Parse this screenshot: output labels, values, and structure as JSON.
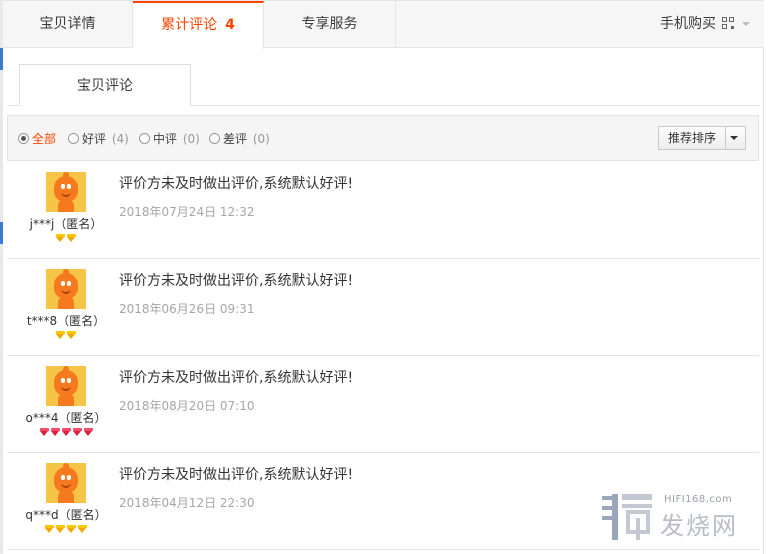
{
  "tabs": {
    "items": [
      "宝贝详情",
      "累计评论",
      "专享服务"
    ],
    "review_count": "4",
    "mobile_label": "手机购买"
  },
  "subtab": {
    "label": "宝贝评论"
  },
  "filter": {
    "options": [
      {
        "label": "全部",
        "count": ""
      },
      {
        "label": "好评",
        "count": "(4)"
      },
      {
        "label": "中评",
        "count": "(0)"
      },
      {
        "label": "差评",
        "count": "(0)"
      }
    ],
    "selected": "全部",
    "sort_label": "推荐排序"
  },
  "reviews": [
    {
      "user": "j***j（匿名）",
      "text": "评价方未及时做出评价,系统默认好评!",
      "date": "2018年07月24日 12:32",
      "rank": {
        "color": "yellow",
        "count": 2
      }
    },
    {
      "user": "t***8（匿名）",
      "text": "评价方未及时做出评价,系统默认好评!",
      "date": "2018年06月26日 09:31",
      "rank": {
        "color": "yellow",
        "count": 2
      }
    },
    {
      "user": "o***4（匿名）",
      "text": "评价方未及时做出评价,系统默认好评!",
      "date": "2018年08月20日 07:10",
      "rank": {
        "color": "red",
        "count": 5
      }
    },
    {
      "user": "q***d（匿名）",
      "text": "评价方未及时做出评价,系统默认好评!",
      "date": "2018年04月12日 22:30",
      "rank": {
        "color": "yellow",
        "count": 4
      }
    }
  ],
  "watermark": {
    "site": "HIFI168.com",
    "name": "发烧网"
  },
  "colors": {
    "accent": "#ff4400",
    "avatar_bg": "#f6c547",
    "mascot": "#f57a1f"
  }
}
